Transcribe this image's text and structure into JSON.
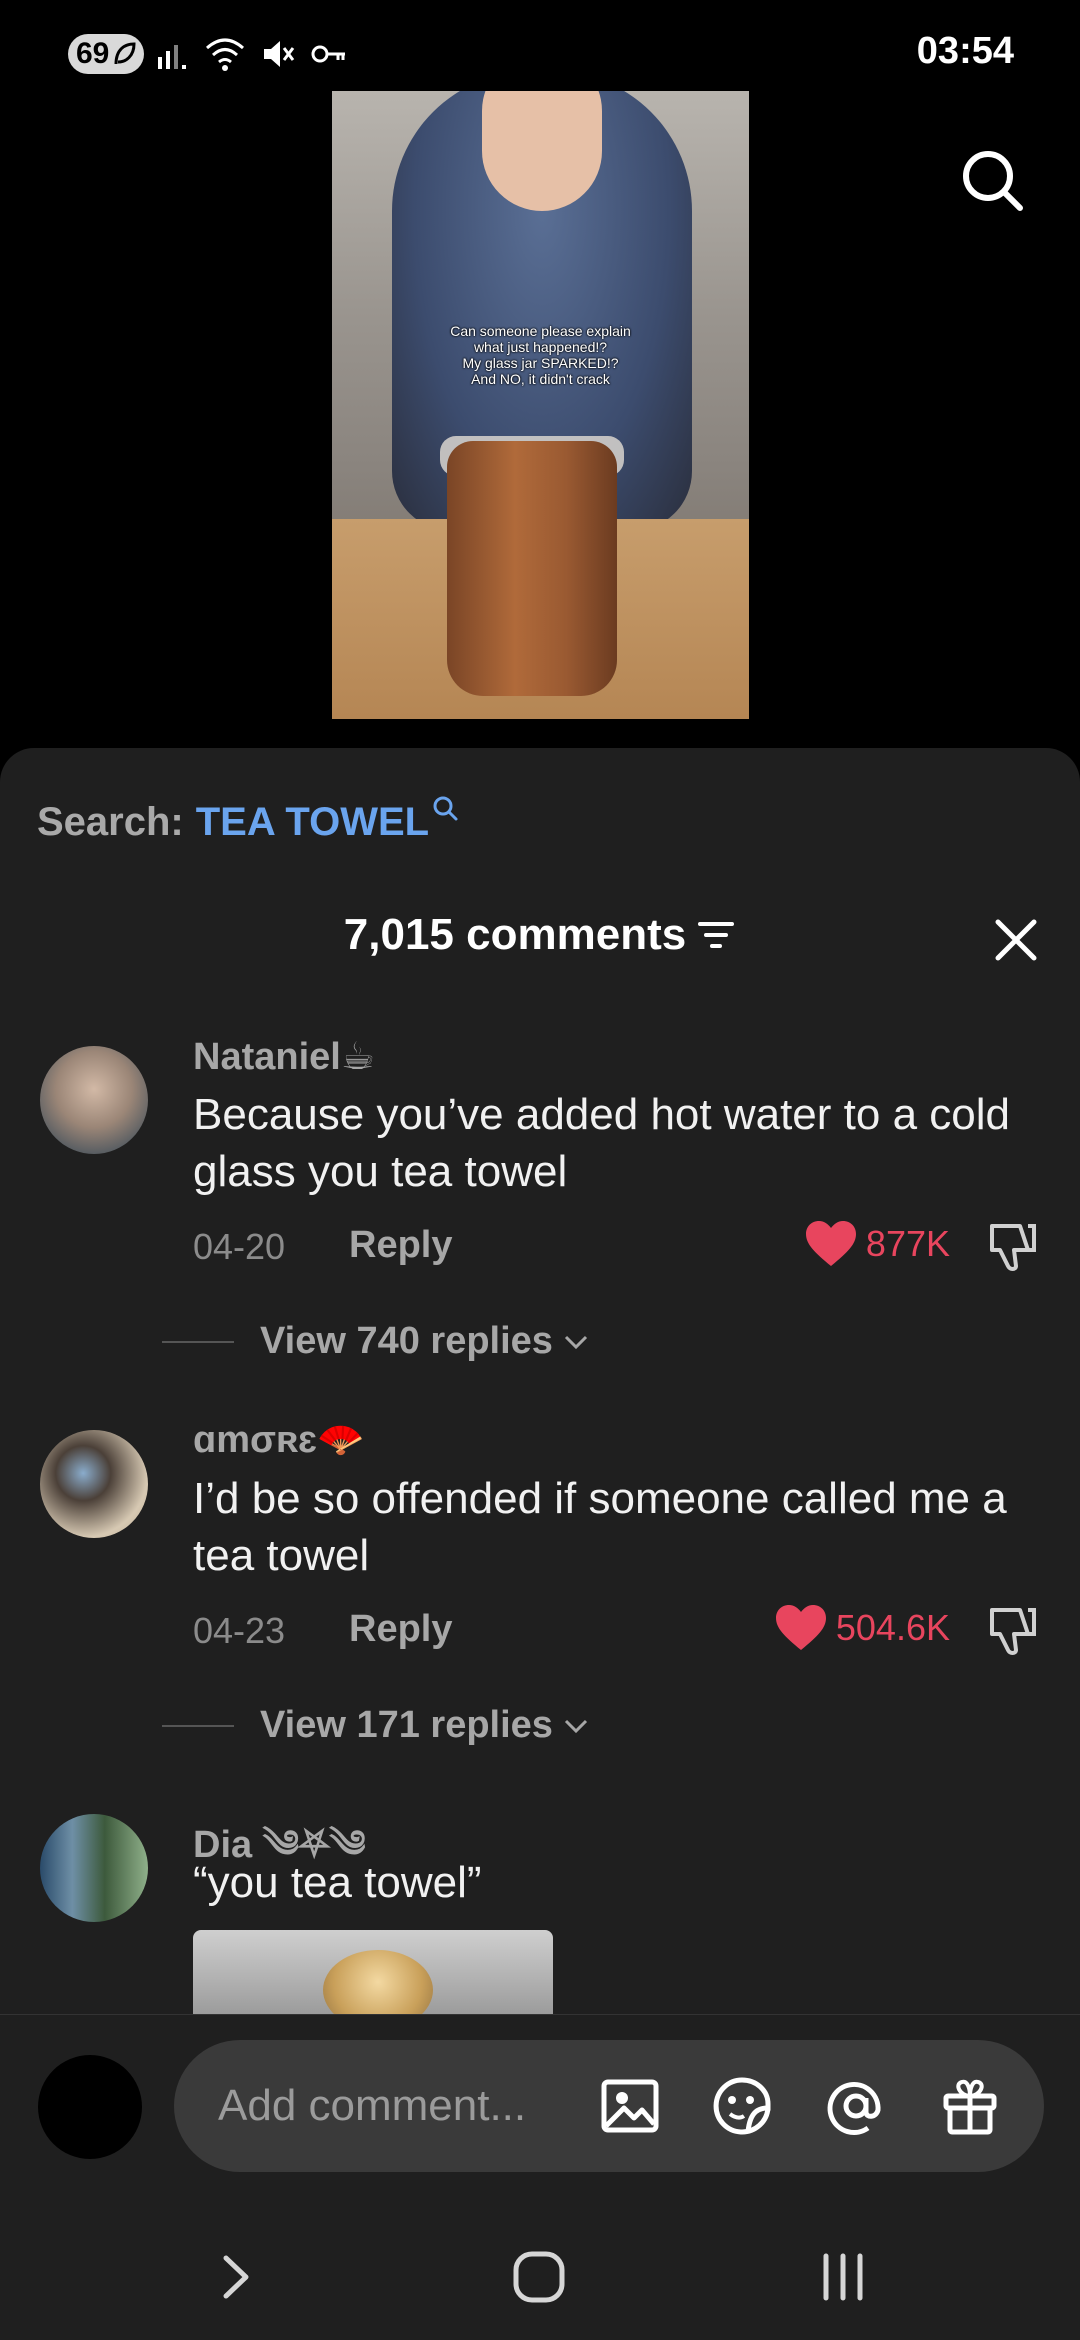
{
  "status_bar": {
    "battery": "69",
    "time": "03:54"
  },
  "video": {
    "caption_lines": [
      "Can someone please explain",
      "what just happened!?",
      "My glass jar SPARKED!?",
      "And NO, it didn't crack"
    ]
  },
  "search": {
    "label": "Search:",
    "term": "TEA TOWEL"
  },
  "comments_header": {
    "count_label": "7,015 comments"
  },
  "comments": [
    {
      "username": "Nataniel☕",
      "text": "Because you’ve added hot water to a cold glass you tea towel",
      "date": "04-20",
      "reply_label": "Reply",
      "likes": "877K",
      "view_replies": "View 740 replies"
    },
    {
      "username": "ɑmσʀɛ🪭",
      "text": "I’d be so offended if someone called me a tea towel",
      "date": "04-23",
      "reply_label": "Reply",
      "likes": "504.6K",
      "view_replies": "View 171 replies"
    },
    {
      "username": "Dia ༄⛧༄",
      "text": "“you tea towel”"
    }
  ],
  "composer": {
    "placeholder": "Add comment..."
  },
  "colors": {
    "accent_link": "#6aa4ee",
    "like_red": "#e8455e",
    "sheet_bg": "#1f1f1f"
  }
}
